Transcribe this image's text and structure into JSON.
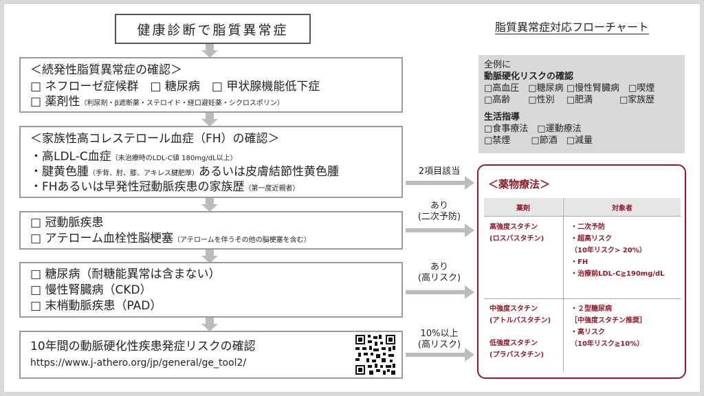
{
  "flowchart_title": "脂質異常症対応フローチャート",
  "start_box": "健康診断で脂質異常症",
  "secondary": {
    "heading": "＜続発性脂質異常症の確認＞",
    "line1": "□ ネフローゼ症候群　□ 糖尿病　□ 甲状腺機能低下症",
    "line2_main": "□ 薬剤性",
    "line2_note": "（利尿剤・β遮断薬・ステロイド・経口避妊薬・シクロスポリン）"
  },
  "fh": {
    "heading": "＜家族性高コレステロール血症（FH）の確認＞",
    "item1_main": "・高LDL-C血症",
    "item1_note": "（未治療時のLDL-C値 180mg/dL以上）",
    "item2_pre": "・腱黄色腫",
    "item2_note": "（手背、肘、膝、アキレス腱肥厚）",
    "item2_post": "あるいは皮膚結節性黄色腫",
    "item3_main": "・FHあるいは早発性冠動脈疾患の家族歴",
    "item3_note": "（第一度近親者）",
    "arrow_label": "2項目該当"
  },
  "secondary_prevention": {
    "line1": "□ 冠動脈疾患",
    "line2_main": "□ アテローム血栓性脳梗塞",
    "line2_note": "（アテロームを伴うその他の脳梗塞を含む）",
    "arrow_label_1": "あり",
    "arrow_label_2": "(二次予防)"
  },
  "high_risk": {
    "line1": "□ 糖尿病（耐糖能異常は含まない）",
    "line2": "□ 慢性腎臓病（CKD）",
    "line3": "□ 末梢動脈疾患（PAD）",
    "arrow_label_1": "あり",
    "arrow_label_2": "(高リスク)"
  },
  "risk_calc": {
    "title": "10年間の動脈硬化性疾患発症リスクの確認",
    "url": "https://www.j-athero.org/jp/general/ge_tool2/",
    "arrow_label_1": "10%以上",
    "arrow_label_2": "(高リスク)"
  },
  "all_cases": {
    "intro": "全例に",
    "risk_heading": "動脈硬化リスクの確認",
    "risk_row1": "□高血圧　□糖尿病 □慢性腎臓病　□喫煙",
    "risk_row2": "□高齢　　□性別　 □肥満　　　□家族歴",
    "lifestyle_heading": "生活指導",
    "lifestyle_row1": "□食事療法　□運動療法",
    "lifestyle_row2": "□禁煙　　 □節酒　□減量"
  },
  "drug_therapy": {
    "title": "＜薬物療法＞",
    "col_drug": "薬剤",
    "col_target": "対象者",
    "high_drug_1": "高強度スタチン",
    "high_drug_2": "(ロスバスタチン)",
    "high_t1": "・二次予防",
    "high_t2": "・超高リスク",
    "high_t3": "（10年リスク> 20%）",
    "high_t4": "・FH",
    "high_t5": "・治療前LDL-C≧190mg/dL",
    "mid_drug_1": "中強度スタチン",
    "mid_drug_2": "(アトルバスタチン)",
    "mid_t1": "・２型糖尿病",
    "mid_t2": "［中強度スタチン推奨］",
    "mid_t3": "・高リスク",
    "mid_t4": "（10年リスク≧10%）",
    "low_drug_1": "低強度スタチン",
    "low_drug_2": "(プラバスタチン)"
  },
  "colors": {
    "accent": "#8b1c2a",
    "arrow": "#bcbcbc",
    "panel": "#d9d9d9"
  }
}
